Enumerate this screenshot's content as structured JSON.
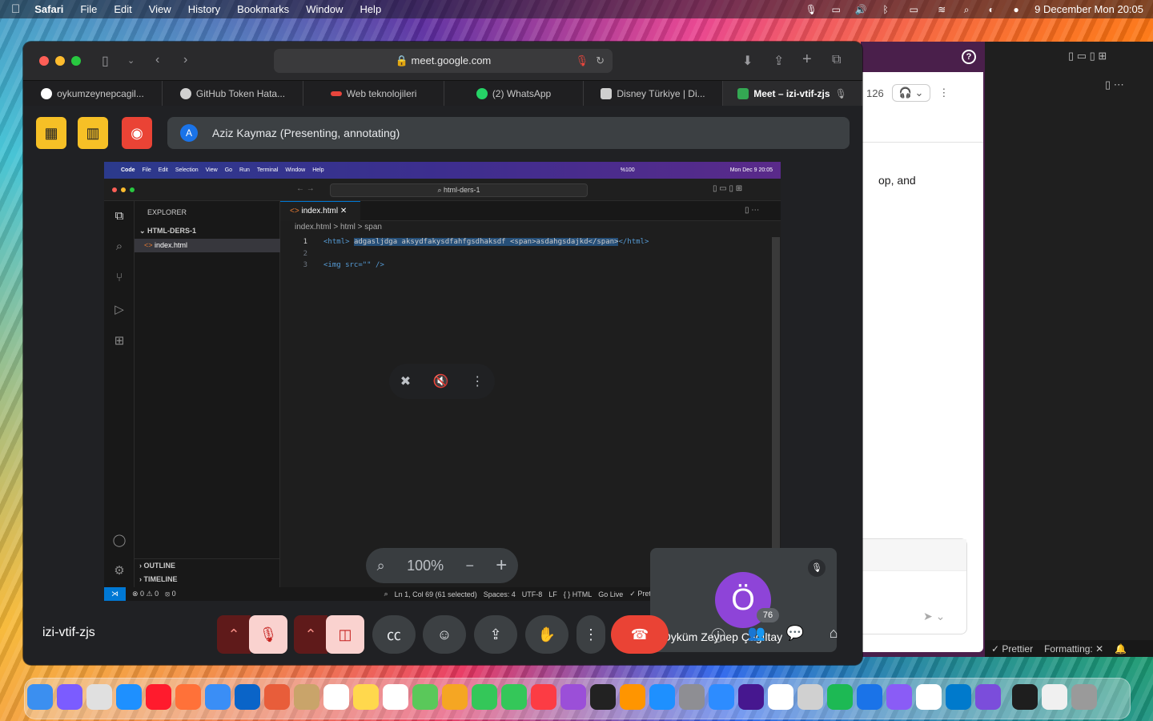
{
  "menubar": {
    "app": "Safari",
    "menus": [
      "File",
      "Edit",
      "View",
      "History",
      "Bookmarks",
      "Window",
      "Help"
    ],
    "datetime": "9 December Mon  20:05"
  },
  "safari": {
    "url": "meet.google.com",
    "tabs": [
      {
        "label": "oykumzeynepcagil...",
        "color": "#ffffff"
      },
      {
        "label": "GitHub Token Hata...",
        "color": "#d0d0d0"
      },
      {
        "label": "Web teknolojileri",
        "color": "#e8453c"
      },
      {
        "label": "(2) WhatsApp",
        "color": "#25d366"
      },
      {
        "label": "Disney Türkiye | Di...",
        "color": "#cfcfcf"
      },
      {
        "label": "Meet – izi-vtif-zjs",
        "color": "#34a853"
      }
    ]
  },
  "meet": {
    "presenter": "Aziz Kaymaz (Presenting, annotating)",
    "presenter_initial": "A",
    "meeting_code": "izi-vtif-zjs",
    "zoom": "100%",
    "participant_name": "Öyküm Zeynep Çağıltay",
    "participant_initial": "Ö",
    "participants_count": "76"
  },
  "shared_screen": {
    "menus": [
      "Code",
      "File",
      "Edit",
      "Selection",
      "View",
      "Go",
      "Run",
      "Terminal",
      "Window",
      "Help"
    ],
    "clock": "Mon Dec 9  20:05",
    "battery": "%100",
    "search": "html-ders-1",
    "explorer_title": "EXPLORER",
    "folder": "HTML-DERS-1",
    "file": "index.html",
    "tab": "index.html",
    "breadcrumb": "index.html  >  html  >  span",
    "lines": [
      "1",
      "2",
      "3"
    ],
    "code1_open": "<html> ",
    "code1_sel": "adgasljdga aksydfakysdfahfgsdhaksdf <span>asdahgsdajkd</span>",
    "code1_close": "</html>",
    "code3": "<img src=\"\" />",
    "outline": "OUTLINE",
    "timeline": "TIMELINE",
    "status_errors": "⊗ 0 ⚠ 0",
    "status_ports": "⦻ 0",
    "status_pos": "Ln 1, Col 69 (61 selected)",
    "status_spaces": "Spaces: 4",
    "status_enc": "UTF-8",
    "status_eol": "LF",
    "status_lang": "{ } HTML",
    "status_live": "Go Live",
    "status_prettier": "✓ Prettier"
  },
  "right_window": {
    "snippet": "op, and",
    "count": "126",
    "status_prettier": "✓ Prettier",
    "status_format": "Formatting: ✕"
  }
}
